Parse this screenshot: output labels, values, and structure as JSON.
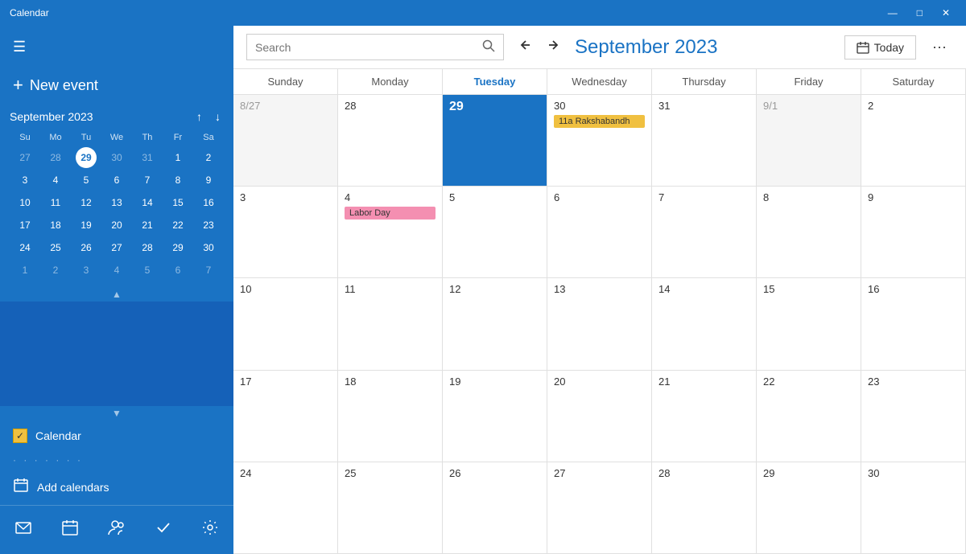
{
  "titleBar": {
    "title": "Calendar",
    "minimizeLabel": "—",
    "maximizeLabel": "□",
    "closeLabel": "✕"
  },
  "sidebar": {
    "hamburgerIcon": "☰",
    "newEventLabel": "New event",
    "newEventIcon": "+",
    "miniCal": {
      "title": "September 2023",
      "prevIcon": "↑",
      "nextIcon": "↓",
      "dayHeaders": [
        "Su",
        "Mo",
        "Tu",
        "We",
        "Th",
        "Fr",
        "Sa"
      ],
      "weeks": [
        [
          "27",
          "28",
          "29",
          "30",
          "31",
          "1",
          "2"
        ],
        [
          "3",
          "4",
          "5",
          "6",
          "7",
          "8",
          "9"
        ],
        [
          "10",
          "11",
          "12",
          "13",
          "14",
          "15",
          "16"
        ],
        [
          "17",
          "18",
          "19",
          "20",
          "21",
          "22",
          "23"
        ],
        [
          "24",
          "25",
          "26",
          "27",
          "28",
          "29",
          "30"
        ],
        [
          "1",
          "2",
          "3",
          "4",
          "5",
          "6",
          "7"
        ]
      ],
      "otherMonthDays": [
        "27",
        "28",
        "31",
        "1",
        "2"
      ],
      "todayDay": "29",
      "lastRowOther": [
        "1",
        "2",
        "3",
        "4",
        "5",
        "6",
        "7"
      ]
    },
    "calendarToggle": {
      "label": "Calendar",
      "checked": true
    },
    "addCalendarsLabel": "Add calendars",
    "addCalendarsIcon": "📅",
    "nav": {
      "mailIcon": "✉",
      "calendarIcon": "📅",
      "peopleIcon": "👥",
      "checkIcon": "✓",
      "settingsIcon": "⚙"
    }
  },
  "toolbar": {
    "searchPlaceholder": "Search",
    "searchIcon": "🔍",
    "prevIcon": "↑",
    "nextIcon": "↓",
    "monthTitle": "September 2023",
    "todayLabel": "Today",
    "todayIcon": "📅",
    "moreIcon": "···"
  },
  "calGrid": {
    "dayHeaders": [
      {
        "label": "Sunday",
        "isToday": false
      },
      {
        "label": "Monday",
        "isToday": false
      },
      {
        "label": "Tuesday",
        "isToday": true
      },
      {
        "label": "Wednesday",
        "isToday": false
      },
      {
        "label": "Thursday",
        "isToday": false
      },
      {
        "label": "Friday",
        "isToday": false
      },
      {
        "label": "Saturday",
        "isToday": false
      }
    ],
    "weeks": [
      [
        {
          "date": "8/27",
          "isOther": true,
          "isToday": false,
          "events": []
        },
        {
          "date": "28",
          "isOther": false,
          "isToday": false,
          "events": []
        },
        {
          "date": "29",
          "isOther": false,
          "isToday": true,
          "events": []
        },
        {
          "date": "30",
          "isOther": false,
          "isToday": false,
          "events": [
            {
              "label": "11a Rakshabandh",
              "type": "yellow"
            }
          ]
        },
        {
          "date": "31",
          "isOther": false,
          "isToday": false,
          "events": []
        },
        {
          "date": "9/1",
          "isOther": true,
          "isToday": false,
          "events": []
        },
        {
          "date": "2",
          "isOther": false,
          "isToday": false,
          "events": []
        }
      ],
      [
        {
          "date": "3",
          "isOther": false,
          "isToday": false,
          "events": []
        },
        {
          "date": "4",
          "isOther": false,
          "isToday": false,
          "events": [
            {
              "label": "Labor Day",
              "type": "pink"
            }
          ]
        },
        {
          "date": "5",
          "isOther": false,
          "isToday": false,
          "events": []
        },
        {
          "date": "6",
          "isOther": false,
          "isToday": false,
          "events": []
        },
        {
          "date": "7",
          "isOther": false,
          "isToday": false,
          "events": []
        },
        {
          "date": "8",
          "isOther": false,
          "isToday": false,
          "events": []
        },
        {
          "date": "9",
          "isOther": false,
          "isToday": false,
          "events": []
        }
      ],
      [
        {
          "date": "10",
          "isOther": false,
          "isToday": false,
          "events": []
        },
        {
          "date": "11",
          "isOther": false,
          "isToday": false,
          "events": []
        },
        {
          "date": "12",
          "isOther": false,
          "isToday": false,
          "events": []
        },
        {
          "date": "13",
          "isOther": false,
          "isToday": false,
          "events": []
        },
        {
          "date": "14",
          "isOther": false,
          "isToday": false,
          "events": []
        },
        {
          "date": "15",
          "isOther": false,
          "isToday": false,
          "events": []
        },
        {
          "date": "16",
          "isOther": false,
          "isToday": false,
          "events": []
        }
      ],
      [
        {
          "date": "17",
          "isOther": false,
          "isToday": false,
          "events": []
        },
        {
          "date": "18",
          "isOther": false,
          "isToday": false,
          "events": []
        },
        {
          "date": "19",
          "isOther": false,
          "isToday": false,
          "events": []
        },
        {
          "date": "20",
          "isOther": false,
          "isToday": false,
          "events": []
        },
        {
          "date": "21",
          "isOther": false,
          "isToday": false,
          "events": []
        },
        {
          "date": "22",
          "isOther": false,
          "isToday": false,
          "events": []
        },
        {
          "date": "23",
          "isOther": false,
          "isToday": false,
          "events": []
        }
      ],
      [
        {
          "date": "24",
          "isOther": false,
          "isToday": false,
          "events": []
        },
        {
          "date": "25",
          "isOther": false,
          "isToday": false,
          "events": []
        },
        {
          "date": "26",
          "isOther": false,
          "isToday": false,
          "events": []
        },
        {
          "date": "27",
          "isOther": false,
          "isToday": false,
          "events": []
        },
        {
          "date": "28",
          "isOther": false,
          "isToday": false,
          "events": []
        },
        {
          "date": "29",
          "isOther": false,
          "isToday": false,
          "events": []
        },
        {
          "date": "30",
          "isOther": false,
          "isToday": false,
          "events": []
        }
      ]
    ]
  }
}
